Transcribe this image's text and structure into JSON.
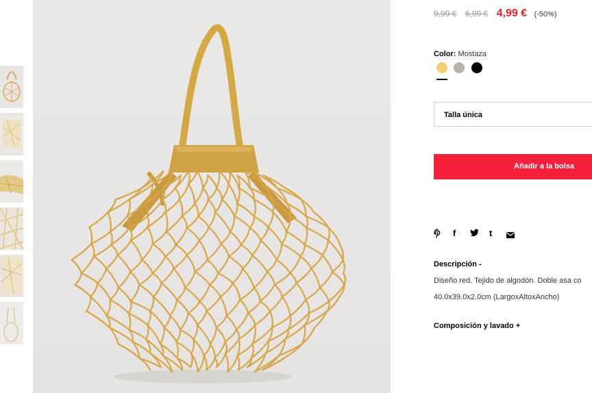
{
  "thumbnails": [
    {
      "label": "thumbnail-1"
    },
    {
      "label": "thumbnail-2"
    },
    {
      "label": "thumbnail-3"
    },
    {
      "label": "thumbnail-4"
    },
    {
      "label": "thumbnail-5"
    },
    {
      "label": "thumbnail-6"
    }
  ],
  "price": {
    "original": "9,99 €",
    "previous": "6,99 €",
    "current": "4,99 €",
    "discount": "(-50%)"
  },
  "color": {
    "label": "Color:",
    "value": "Mostaza",
    "swatches": [
      {
        "name": "mostaza",
        "hex": "#f2cf72"
      },
      {
        "name": "beige",
        "hex": "#b9b2a6"
      },
      {
        "name": "negro",
        "hex": "#000000"
      }
    ]
  },
  "size": {
    "selected": "Talla única"
  },
  "cart": {
    "add_label": "Añadir a la bolsa"
  },
  "share": {
    "pinterest": "𝓅",
    "facebook": "f",
    "twitter": "🐦",
    "tumblr": "t",
    "email": "✉"
  },
  "description": {
    "title": "Descripción",
    "toggle": "-",
    "line1": "Diseño red. Tejido de algodón. Doble asa co",
    "line2": "40.0x39.0x2.0cm (LargoxAltoxAncho)"
  },
  "composition": {
    "title": "Composición y lavado",
    "toggle": "+"
  },
  "colors": {
    "accent": "#e1262d",
    "button": "#f5213b",
    "bag": "#d9a94a"
  }
}
